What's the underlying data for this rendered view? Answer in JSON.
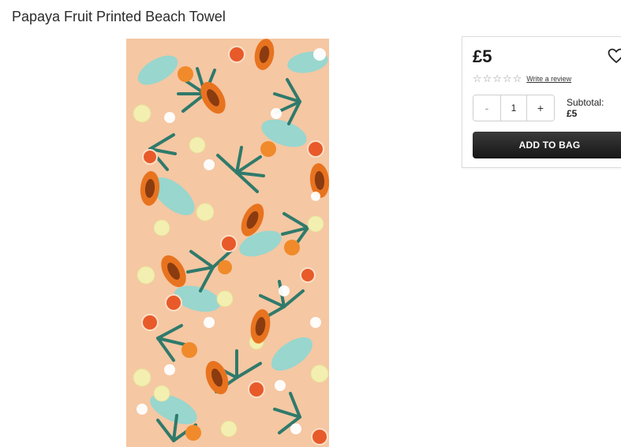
{
  "product": {
    "title": "Papaya Fruit Printed Beach Towel"
  },
  "purchase": {
    "price": "£5",
    "rating_stars": 0,
    "rating_max": 5,
    "review_link": "Write a review",
    "quantity": {
      "minus": "-",
      "value": "1",
      "plus": "+"
    },
    "subtotal_label": "Subtotal:",
    "subtotal_value": "£5",
    "add_to_bag": "ADD TO BAG"
  },
  "icons": {
    "wishlist": "heart-outline-icon",
    "star": "star-outline-icon"
  },
  "colors": {
    "towel_base": "#f5c7a3",
    "leaf_dark": "#2f7a6b",
    "leaf_light": "#7fd3cf",
    "papaya": "#e8731f",
    "lemon": "#f3efb0",
    "button": "#1c1c1c"
  }
}
